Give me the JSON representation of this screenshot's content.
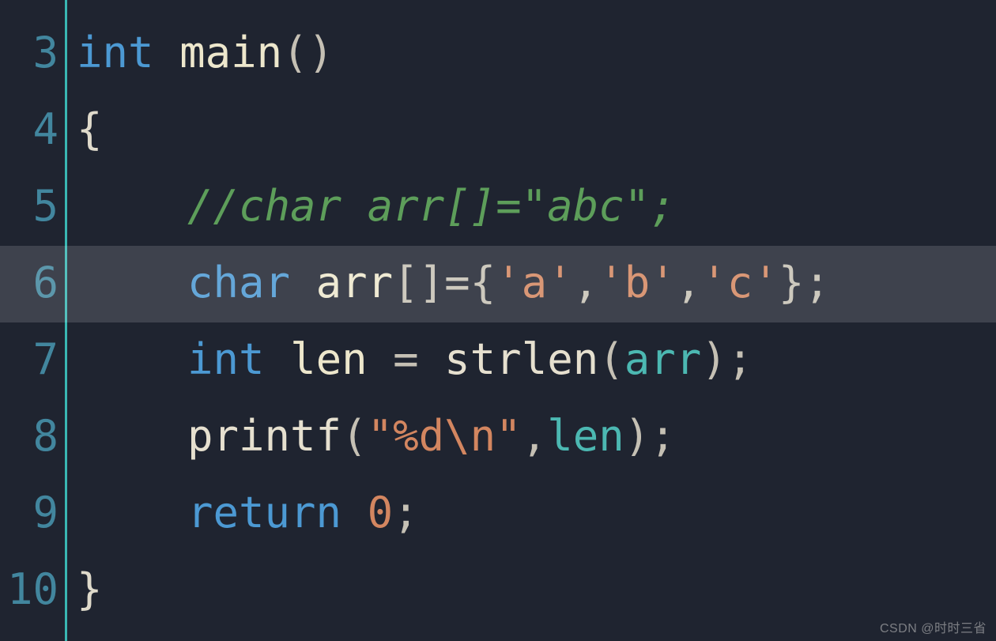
{
  "editor": {
    "active_line_index": 3,
    "lines": [
      {
        "num": "3"
      },
      {
        "num": "4"
      },
      {
        "num": "5"
      },
      {
        "num": "6"
      },
      {
        "num": "7"
      },
      {
        "num": "8"
      },
      {
        "num": "9"
      },
      {
        "num": "10"
      }
    ],
    "tokens": {
      "l3": {
        "kw": "int",
        "sp": " ",
        "fn": "main",
        "paren": "()"
      },
      "l4": {
        "brace": "{"
      },
      "l5": {
        "comment": "//char arr[]=\"abc\";"
      },
      "l6": {
        "kw": "char",
        "sp": " ",
        "id": "arr",
        "br": "[]",
        "eq": "=",
        "ob": "{",
        "c1": "'a'",
        "cm1": ",",
        "c2": "'b'",
        "cm2": ",",
        "c3": "'c'",
        "cb": "}",
        "semi": ";"
      },
      "l7": {
        "kw": "int",
        "sp": " ",
        "id": "len",
        "eq": " = ",
        "fn": "strlen",
        "op": "(",
        "arg": "arr",
        "cp": ")",
        "semi": ";"
      },
      "l8": {
        "fn": "printf",
        "op": "(",
        "str": "\"%d\\n\"",
        "cm": ",",
        "arg": "len",
        "cp": ")",
        "semi": ";"
      },
      "l9": {
        "kw": "return",
        "sp": " ",
        "val": "0",
        "semi": ";"
      },
      "l10": {
        "brace": "}"
      }
    }
  },
  "watermark": "CSDN @时时三省"
}
